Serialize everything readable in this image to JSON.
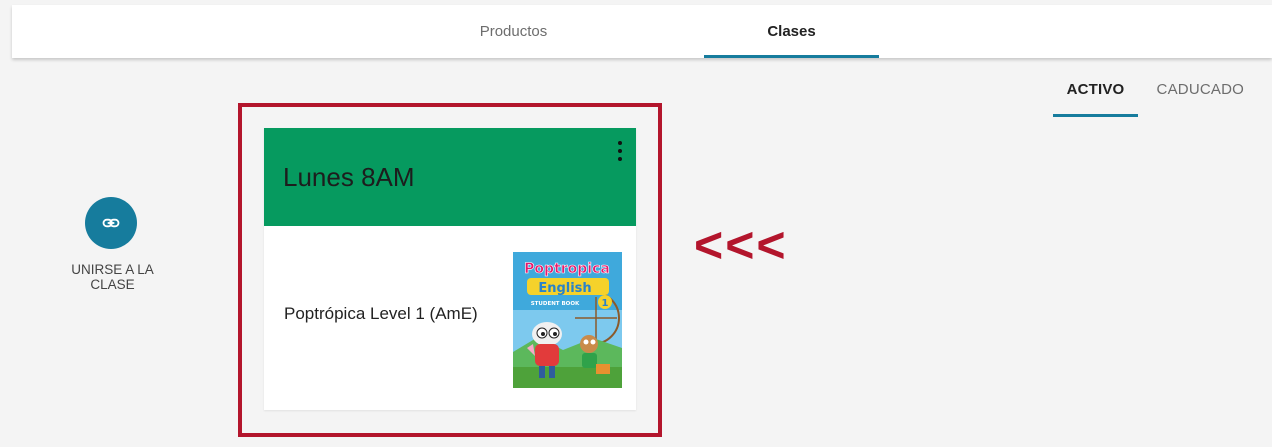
{
  "nav": {
    "tabs": [
      {
        "label": "Productos",
        "active": false
      },
      {
        "label": "Clases",
        "active": true
      }
    ],
    "accent_color": "#167c9d"
  },
  "status_filter": {
    "tabs": [
      {
        "label": "ACTIVO",
        "active": true
      },
      {
        "label": "CADUCADO",
        "active": false
      }
    ]
  },
  "join": {
    "icon": "link-icon",
    "label": "UNIRSE A LA CLASE"
  },
  "class_card": {
    "title": "Lunes 8AM",
    "header_color": "#069a5f",
    "menu_icon": "more-vert-icon",
    "product": "Poptrópica Level 1 (AmE)",
    "cover": {
      "title_line1": "Poptropica",
      "title_line2": "English",
      "subtitle": "STUDENT BOOK",
      "level": "1"
    }
  },
  "annotation": {
    "arrows": "<<<",
    "color": "#b3152c"
  }
}
